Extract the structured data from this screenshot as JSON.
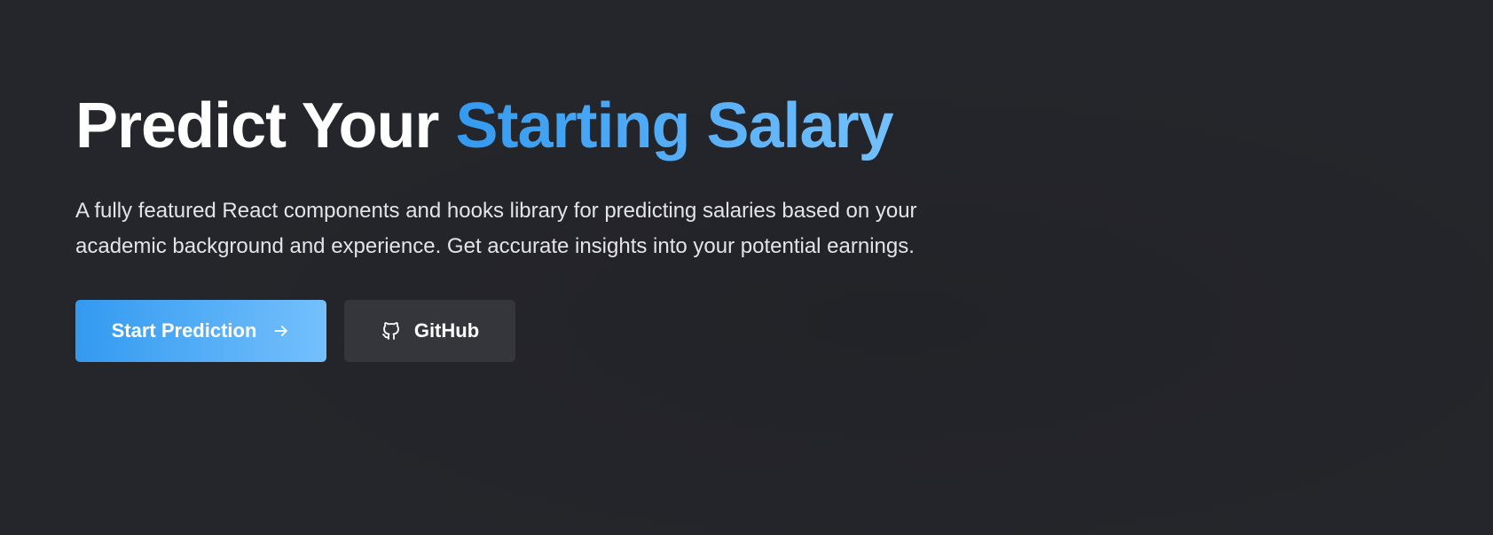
{
  "hero": {
    "title_plain": "Predict Your ",
    "title_accent": "Starting Salary",
    "description": "A fully featured React components and hooks library for predicting salaries based on your academic background and experience. Get accurate insights into your potential earnings.",
    "primary_button": {
      "label": "Start Prediction",
      "icon": "arrow-right-icon"
    },
    "secondary_button": {
      "label": "GitHub",
      "icon": "github-icon"
    }
  },
  "colors": {
    "background": "#25262b",
    "accent_start": "#339af0",
    "accent_end": "#74c0fc",
    "secondary_button": "#35363b",
    "text": "#ffffff"
  }
}
